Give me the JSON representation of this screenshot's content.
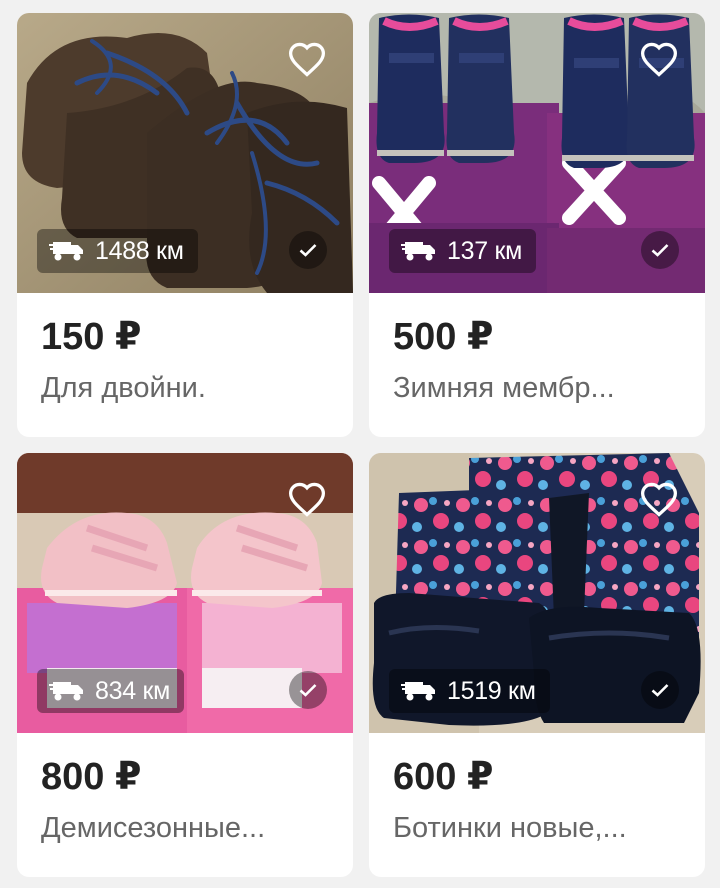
{
  "listings": [
    {
      "price": "150 ₽",
      "title": "Для двойни.",
      "distance": "1488 км",
      "favorite_icon": "heart-outline-icon",
      "delivery_icon": "truck-icon",
      "verified_icon": "check-icon"
    },
    {
      "price": "500 ₽",
      "title": "Зимняя мембр...",
      "distance": "137 км",
      "favorite_icon": "heart-outline-icon",
      "delivery_icon": "truck-icon",
      "verified_icon": "check-icon"
    },
    {
      "price": "800 ₽",
      "title": "Демисезонные...",
      "distance": "834 км",
      "favorite_icon": "heart-outline-icon",
      "delivery_icon": "truck-icon",
      "verified_icon": "check-icon"
    },
    {
      "price": "600 ₽",
      "title": "Ботинки новые,...",
      "distance": "1519 км",
      "favorite_icon": "heart-outline-icon",
      "delivery_icon": "truck-icon",
      "verified_icon": "check-icon"
    }
  ],
  "colors": {
    "background": "#f1f1f1",
    "card": "#ffffff",
    "price": "#222222",
    "title": "#666666"
  }
}
